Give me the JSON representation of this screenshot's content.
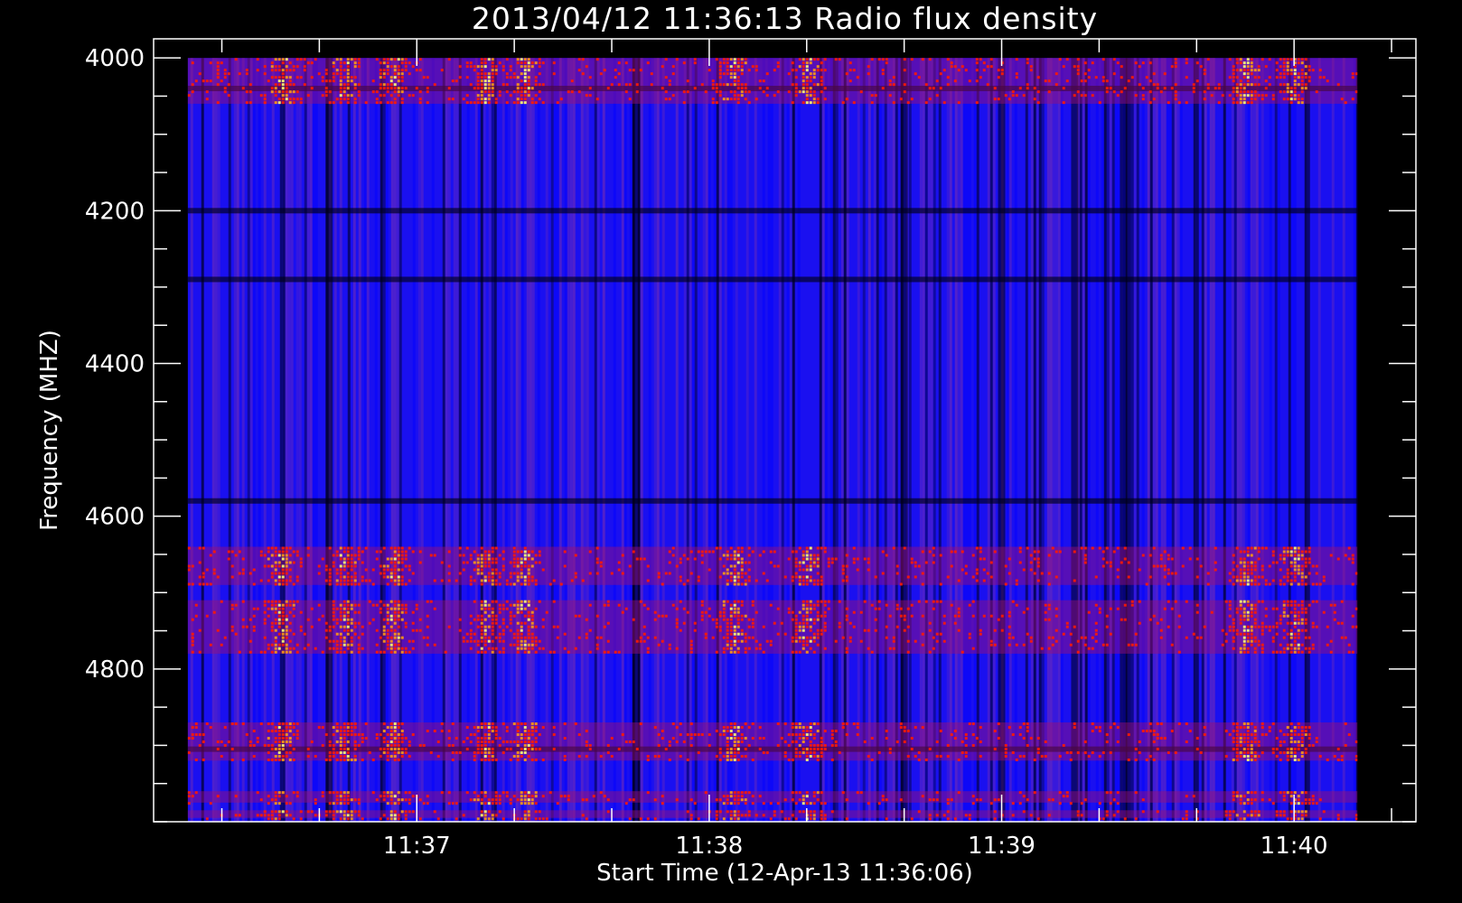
{
  "chart_data": {
    "type": "heatmap",
    "title": "2013/04/12 11:36:13 Radio flux density",
    "xlabel": "Start Time (12-Apr-13 11:36:06)",
    "ylabel": "Frequency (MHZ)",
    "x_axis": {
      "unit": "time",
      "range": [
        "11:36:06",
        "11:40:25"
      ],
      "data_range": [
        "11:36:13",
        "11:40:13"
      ],
      "major_ticks": [
        "11:37",
        "11:38",
        "11:39",
        "11:40"
      ],
      "minor_tick_interval_seconds": 20
    },
    "y_axis": {
      "unit": "MHz",
      "range": [
        3975,
        5000
      ],
      "data_range": [
        4000,
        5000
      ],
      "inverted": true,
      "major_ticks": [
        4000,
        4200,
        4400,
        4600,
        4800
      ],
      "minor_tick_interval": 50
    },
    "colormap": [
      "#000000",
      "#0000ff",
      "#7a2fb0",
      "#ff0000",
      "#ffa500",
      "#ffff60"
    ],
    "grid": false,
    "bright_frequency_bands_mhz": [
      [
        4000,
        4060
      ],
      [
        4640,
        4690
      ],
      [
        4710,
        4780
      ],
      [
        4870,
        4920
      ],
      [
        4960,
        4975
      ],
      [
        4985,
        4995
      ]
    ],
    "dark_frequency_lines_mhz": [
      4040,
      4200,
      4290,
      4580,
      4905
    ],
    "bright_time_columns": [
      "11:36:32",
      "11:36:45",
      "11:36:55",
      "11:37:14",
      "11:37:22",
      "11:38:05",
      "11:38:20",
      "11:39:50",
      "11:40:00"
    ],
    "dark_time_columns": [
      "11:36:42",
      "11:37:45",
      "11:38:40",
      "11:39:00",
      "11:39:15",
      "11:39:25"
    ]
  }
}
